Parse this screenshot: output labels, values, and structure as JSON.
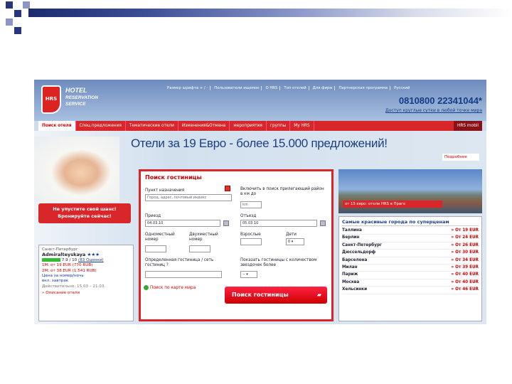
{
  "header": {
    "logo": "HRS",
    "logo_lines": [
      "HOTEL",
      "RESERVATION",
      "SERVICE"
    ],
    "top_links": [
      "Размер шрифта + / -",
      "Пользователи ищемое",
      "О HRS",
      "Топ отелей",
      "Для фирм",
      "Партнерская программа",
      "Русский"
    ],
    "phone": "0810800 22341044*",
    "phone_note": "Доступ круглые сутки в любой точке мира"
  },
  "nav": {
    "items": [
      "Поиск отеля",
      "Спец.предложения",
      "Тематические отели",
      "Изменения&Отмена",
      "мероприятия",
      "группы",
      "My HRS"
    ],
    "mobile": "HRS mobil"
  },
  "banner": {
    "text": "Отели за 19 Евро - более 15.000 предложений!",
    "more": "Подробнее"
  },
  "promo": {
    "lines": [
      "Не упустите свой шанс!",
      "Бронируйте сейчас!"
    ]
  },
  "hotel": {
    "city": "Санкт-Петербург",
    "name": "Admiralteyskaya",
    "stars": "★★★",
    "rating": "7.9 / 10",
    "reviews": "(83 Оценки)",
    "price_1m": "1M: от 19 EUR (770 RUB)",
    "price_2m": "2M: от 38 EUR (1.541 RUB)",
    "note_a": "Цена за номер/ночь",
    "note_b": "вкл. завтрак",
    "validity": "Действительно: 15.03 – 21.03.",
    "description_link": "Описание отеля"
  },
  "search": {
    "title": "Поиск гостиницы",
    "destination_label": "Пункт назначения",
    "destination_placeholder": "Город, адрес, почтовый индекс",
    "nearby_label": "Включить в поиск прилегающий район в км до",
    "km_value": "km",
    "arrival_label": "Приезд",
    "arrival_value": "04.03.10",
    "departure_label": "Отъезд",
    "departure_value": "05.03.10",
    "single_label": "Одноместный номер",
    "double_label": "Двухместный номер",
    "adults_label": "Взрослые",
    "children_label": "Дети",
    "children_value": "0",
    "chain_label": "Определенная гостиница / сеть гостиниц ?",
    "stars_label": "Показать гостиницы с количеством звездочек более",
    "stars_value": "--",
    "map_link": "Поиск по карте мира",
    "button": "Поиск гостиницы"
  },
  "photo_caption": "от 15 евро: отели HRS в Праге",
  "cities": {
    "title": "Самые красивые города по суперценам",
    "rows": [
      {
        "name": "Таллина",
        "price": "От 19 EUR"
      },
      {
        "name": "Берлин",
        "price": "От 24 EUR"
      },
      {
        "name": "Санкт-Петербург",
        "price": "От 26 EUR"
      },
      {
        "name": "Дюссельдорф",
        "price": "От 30 EUR"
      },
      {
        "name": "Барселона",
        "price": "От 34 EUR"
      },
      {
        "name": "Милан",
        "price": "От 39 EUR"
      },
      {
        "name": "Париж",
        "price": "От 40 EUR"
      },
      {
        "name": "Москва",
        "price": "От 40 EUR"
      },
      {
        "name": "Хельсинки",
        "price": "От 46 EUR"
      }
    ]
  }
}
